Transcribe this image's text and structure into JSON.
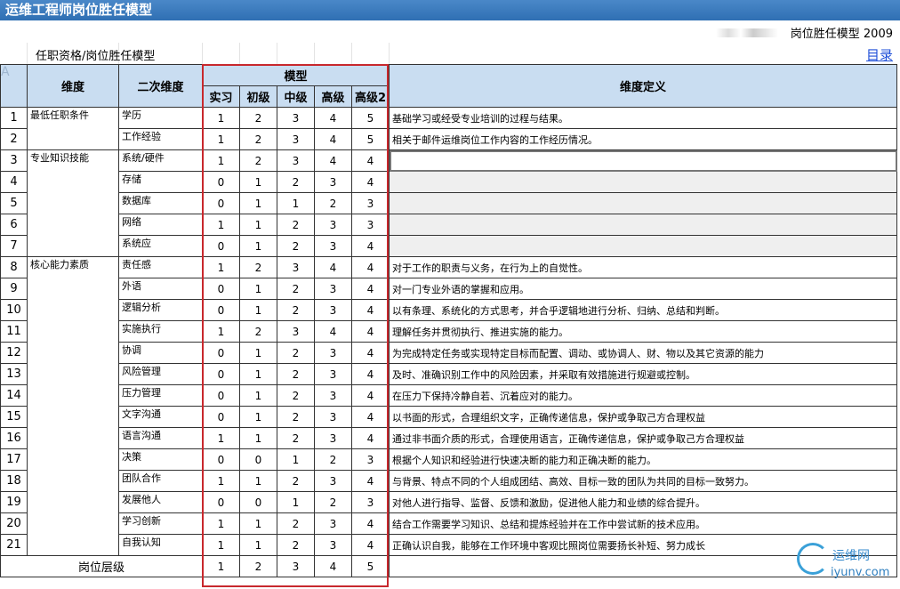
{
  "title": "运维工程师岗位胜任模型",
  "credit": "岗位胜任模型 2009",
  "subtitle": "任职资格/岗位胜任模型",
  "toc_link": "目录",
  "corner_glyph": "A",
  "headers": {
    "dim": "维度",
    "subdim": "二次维度",
    "model": "模型",
    "levels": [
      "实习",
      "初级",
      "中级",
      "高级",
      "高级2"
    ],
    "definition": "维度定义"
  },
  "groups": [
    {
      "label": "最低任职条件",
      "start": 0,
      "span": 2
    },
    {
      "label": "专业知识技能",
      "start": 2,
      "span": 5
    },
    {
      "label": "核心能力素质",
      "start": 7,
      "span": 14
    }
  ],
  "rows": [
    {
      "n": "1",
      "sub": "学历",
      "v": [
        "1",
        "2",
        "3",
        "4",
        "5"
      ],
      "def": "基础学习或经受专业培训的过程与结果。"
    },
    {
      "n": "2",
      "sub": "工作经验",
      "v": [
        "1",
        "2",
        "3",
        "4",
        "5"
      ],
      "def": "相关于邮件运维岗位工作内容的工作经历情况。"
    },
    {
      "n": "3",
      "sub": "系统/硬件",
      "v": [
        "1",
        "2",
        "3",
        "4",
        "4"
      ],
      "def": ""
    },
    {
      "n": "4",
      "sub": "存储",
      "v": [
        "0",
        "1",
        "2",
        "3",
        "4"
      ],
      "def": ""
    },
    {
      "n": "5",
      "sub": "数据库",
      "v": [
        "0",
        "1",
        "1",
        "2",
        "3"
      ],
      "def": ""
    },
    {
      "n": "6",
      "sub": "网络",
      "v": [
        "1",
        "1",
        "2",
        "3",
        "3"
      ],
      "def": ""
    },
    {
      "n": "7",
      "sub": "系统应",
      "v": [
        "0",
        "1",
        "2",
        "3",
        "4"
      ],
      "def": ""
    },
    {
      "n": "8",
      "sub": "责任感",
      "v": [
        "1",
        "2",
        "3",
        "4",
        "4"
      ],
      "def": "对于工作的职责与义务，在行为上的自觉性。"
    },
    {
      "n": "9",
      "sub": "外语",
      "v": [
        "0",
        "1",
        "2",
        "3",
        "4"
      ],
      "def": "对一门专业外语的掌握和应用。"
    },
    {
      "n": "10",
      "sub": "逻辑分析",
      "v": [
        "0",
        "1",
        "2",
        "3",
        "4"
      ],
      "def": "以有条理、系统化的方式思考，并合乎逻辑地进行分析、归纳、总结和判断。"
    },
    {
      "n": "11",
      "sub": "实施执行",
      "v": [
        "1",
        "2",
        "3",
        "4",
        "4"
      ],
      "def": "理解任务并贯彻执行、推进实施的能力。"
    },
    {
      "n": "12",
      "sub": "协调",
      "v": [
        "0",
        "1",
        "2",
        "3",
        "4"
      ],
      "def": "为完成特定任务或实现特定目标而配置、调动、或协调人、财、物以及其它资源的能力"
    },
    {
      "n": "13",
      "sub": "风险管理",
      "v": [
        "0",
        "1",
        "2",
        "3",
        "4"
      ],
      "def": "及时、准确识别工作中的风险因素，并采取有效措施进行规避或控制。"
    },
    {
      "n": "14",
      "sub": "压力管理",
      "v": [
        "0",
        "1",
        "2",
        "3",
        "4"
      ],
      "def": "在压力下保持冷静自若、沉着应对的能力。"
    },
    {
      "n": "15",
      "sub": "文字沟通",
      "v": [
        "0",
        "1",
        "2",
        "3",
        "4"
      ],
      "def": "以书面的形式，合理组织文字，正确传递信息，保护或争取己方合理权益"
    },
    {
      "n": "16",
      "sub": "语言沟通",
      "v": [
        "1",
        "1",
        "2",
        "3",
        "4"
      ],
      "def": "通过非书面介质的形式，合理使用语言，正确传递信息，保护或争取己方合理权益"
    },
    {
      "n": "17",
      "sub": "决策",
      "v": [
        "0",
        "0",
        "1",
        "2",
        "3"
      ],
      "def": "根据个人知识和经验进行快速决断的能力和正确决断的能力。"
    },
    {
      "n": "18",
      "sub": "团队合作",
      "v": [
        "1",
        "1",
        "2",
        "3",
        "4"
      ],
      "def": "与背景、特点不同的个人组成团结、高效、目标一致的团队为共同的目标一致努力。"
    },
    {
      "n": "19",
      "sub": "发展他人",
      "v": [
        "0",
        "0",
        "1",
        "2",
        "3"
      ],
      "def": "对他人进行指导、监督、反馈和激励，促进他人能力和业绩的综合提升。"
    },
    {
      "n": "20",
      "sub": "学习创新",
      "v": [
        "1",
        "1",
        "2",
        "3",
        "4"
      ],
      "def": "结合工作需要学习知识、总结和提炼经验并在工作中尝试新的技术应用。"
    },
    {
      "n": "21",
      "sub": "自我认知",
      "v": [
        "1",
        "1",
        "2",
        "3",
        "4"
      ],
      "def": "正确认识自我，能够在工作环境中客观比照岗位需要扬长补短、努力成长"
    }
  ],
  "footer": {
    "label": "岗位层级",
    "values": [
      "1",
      "2",
      "3",
      "4",
      "5"
    ]
  },
  "watermark": {
    "line1": "运维网",
    "line2": "iyunv.com"
  },
  "colors": {
    "header_bg": "#c9ddf1",
    "title_bg": "#2f6fb3",
    "model_border": "#c8282d",
    "link": "#1f4fd8"
  }
}
